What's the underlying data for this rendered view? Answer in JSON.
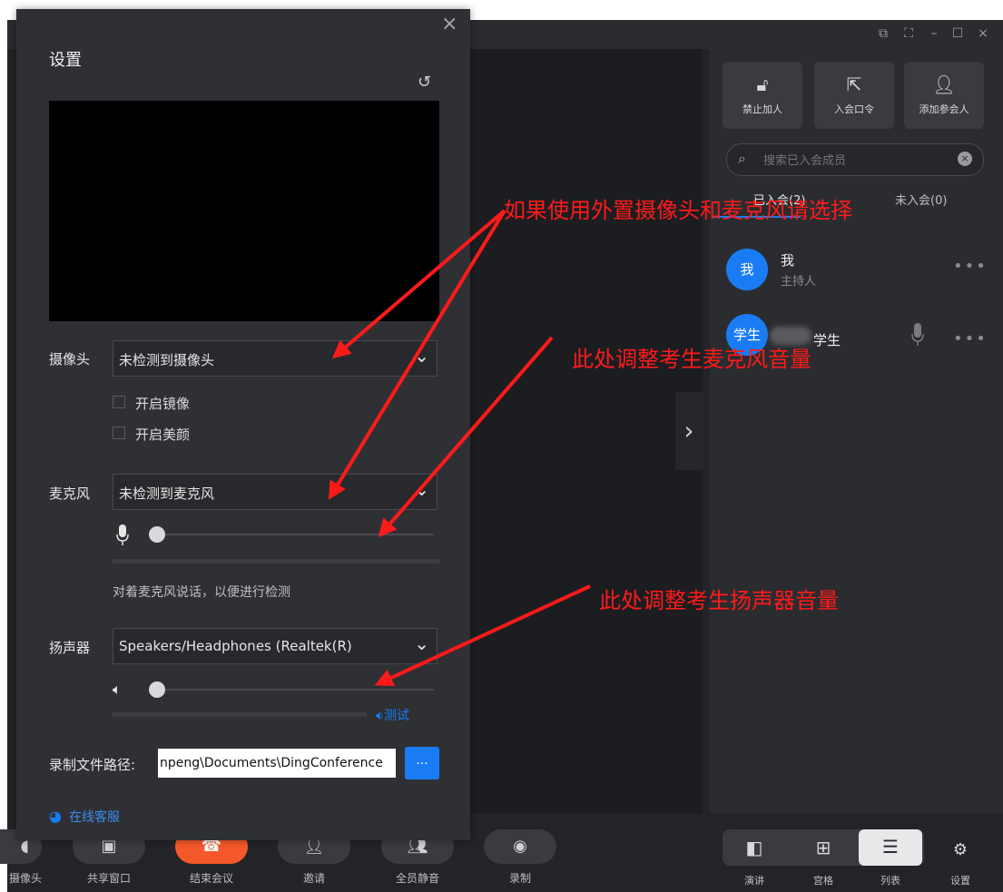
{
  "window": {
    "controls": [
      "⧉",
      "⛶",
      "–",
      "☐",
      "×"
    ]
  },
  "participants_panel": {
    "top_buttons": [
      {
        "label": "禁止加人",
        "icon": "lock-icon"
      },
      {
        "label": "入会口令",
        "icon": "share-icon"
      },
      {
        "label": "添加参会人",
        "icon": "add-user-icon"
      }
    ],
    "search_placeholder": "搜索已入会成员",
    "tabs": [
      {
        "label": "已入会(2)",
        "active": true
      },
      {
        "label": "未入会(0)",
        "active": false
      }
    ],
    "members": [
      {
        "avatar": "我",
        "name": "我",
        "role": "主持人"
      },
      {
        "avatar": "学生",
        "name": "学生",
        "role": ""
      }
    ],
    "more": "•••"
  },
  "bottom_toolbar": {
    "left_items": [
      {
        "label": "摄像头",
        "icon": "camera-icon"
      },
      {
        "label": "共享窗口",
        "icon": "share-screen-icon"
      },
      {
        "label": "结束会议",
        "icon": "end-call-icon"
      },
      {
        "label": "邀请",
        "icon": "invite-icon"
      },
      {
        "label": "全员静音",
        "icon": "mute-all-icon"
      },
      {
        "label": "录制",
        "icon": "record-icon"
      }
    ],
    "view_items": [
      {
        "label": "演讲",
        "icon": "speaker-view-icon"
      },
      {
        "label": "宫格",
        "icon": "grid-view-icon"
      },
      {
        "label": "列表",
        "icon": "list-view-icon",
        "active": true
      }
    ],
    "settings_label": "设置"
  },
  "settings_dialog": {
    "title": "设置",
    "camera": {
      "label": "摄像头",
      "value": "未检测到摄像头",
      "mirror_label": "开启镜像",
      "beauty_label": "开启美颜"
    },
    "microphone": {
      "label": "麦克风",
      "value": "未检测到麦克风",
      "volume": 0,
      "hint": "对着麦克风说话，以便进行检测"
    },
    "speaker": {
      "label": "扬声器",
      "value": "Speakers/Headphones (Realtek(R)",
      "volume": 0,
      "test_label": "测试"
    },
    "record_path": {
      "label": "录制文件路径:",
      "value": "npeng\\Documents\\DingConference",
      "browse_label": "..."
    },
    "support_label": "在线客服"
  },
  "annotations": [
    {
      "text": "如果使用外置摄像头和麦克风请选择"
    },
    {
      "text": "此处调整考生麦克风音量"
    },
    {
      "text": "此处调整考生扬声器音量"
    }
  ],
  "colors": {
    "accent": "#1a7cf5",
    "end_call": "#f5582a",
    "annotation": "#ff1a1a"
  }
}
